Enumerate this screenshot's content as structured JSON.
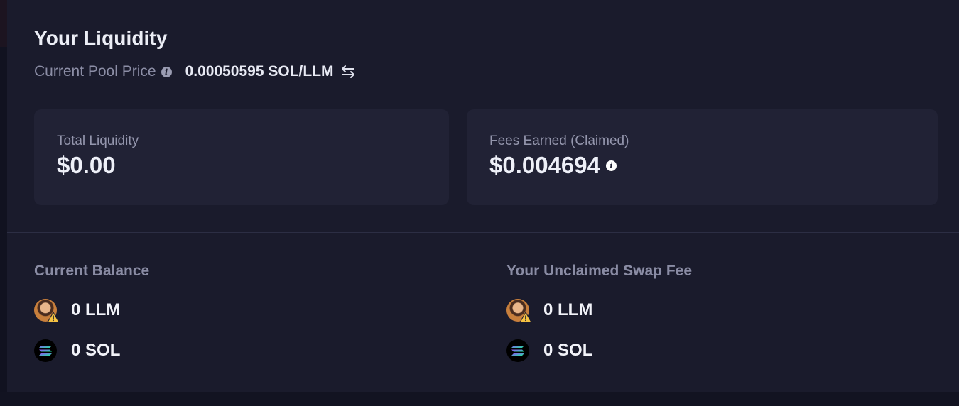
{
  "liquidity": {
    "title": "Your Liquidity",
    "pool_price_label": "Current Pool Price",
    "pool_price_value": "0.00050595 SOL/LLM"
  },
  "stats": {
    "total_liquidity_label": "Total Liquidity",
    "total_liquidity_value": "$0.00",
    "fees_earned_label": "Fees Earned (Claimed)",
    "fees_earned_value": "$0.004694"
  },
  "balance": {
    "title": "Current Balance",
    "items": [
      {
        "amount": "0 LLM",
        "icon": "llm-token-icon"
      },
      {
        "amount": "0 SOL",
        "icon": "sol-token-icon"
      }
    ]
  },
  "unclaimed": {
    "title": "Your Unclaimed Swap Fee",
    "items": [
      {
        "amount": "0 LLM",
        "icon": "llm-token-icon"
      },
      {
        "amount": "0 SOL",
        "icon": "sol-token-icon"
      }
    ]
  },
  "colors": {
    "background": "#1a1b2c",
    "card": "#212235",
    "muted_text": "#8c8ea6",
    "warning": "#f5c242",
    "sol_gradient_start": "#9945ff",
    "sol_gradient_end": "#14f195"
  }
}
